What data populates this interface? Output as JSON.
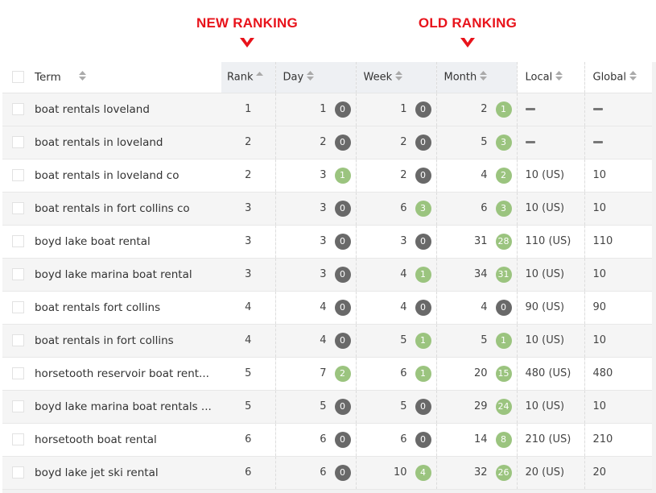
{
  "annotations": {
    "new_ranking": "NEW RANKING",
    "old_ranking": "OLD RANKING",
    "color": "#e8131b"
  },
  "table": {
    "headers": {
      "term": "Term",
      "rank": "Rank",
      "day": "Day",
      "week": "Week",
      "month": "Month",
      "local": "Local",
      "global": "Global"
    },
    "sort": {
      "column": "rank",
      "direction": "ascending"
    },
    "colors": {
      "badge_zero": "#696969",
      "badge_up": "#9bc47f",
      "header_shaded": "#eef0f3"
    },
    "rows": [
      {
        "term": "boat rentals loveland",
        "rank": "1",
        "day": "1",
        "day_change": "0",
        "week": "1",
        "week_change": "0",
        "month": "2",
        "month_change": "1",
        "local": "—",
        "global": "—"
      },
      {
        "term": "boat rentals in loveland",
        "rank": "2",
        "day": "2",
        "day_change": "0",
        "week": "2",
        "week_change": "0",
        "month": "5",
        "month_change": "3",
        "local": "—",
        "global": "—"
      },
      {
        "term": "boat rentals in loveland co",
        "rank": "2",
        "day": "3",
        "day_change": "1",
        "week": "2",
        "week_change": "0",
        "month": "4",
        "month_change": "2",
        "local": "10 (US)",
        "global": "10"
      },
      {
        "term": "boat rentals in fort collins co",
        "rank": "3",
        "day": "3",
        "day_change": "0",
        "week": "6",
        "week_change": "3",
        "month": "6",
        "month_change": "3",
        "local": "10 (US)",
        "global": "10"
      },
      {
        "term": "boyd lake boat rental",
        "rank": "3",
        "day": "3",
        "day_change": "0",
        "week": "3",
        "week_change": "0",
        "month": "31",
        "month_change": "28",
        "local": "110 (US)",
        "global": "110"
      },
      {
        "term": "boyd lake marina boat rental",
        "rank": "3",
        "day": "3",
        "day_change": "0",
        "week": "4",
        "week_change": "1",
        "month": "34",
        "month_change": "31",
        "local": "10 (US)",
        "global": "10"
      },
      {
        "term": "boat rentals fort collins",
        "rank": "4",
        "day": "4",
        "day_change": "0",
        "week": "4",
        "week_change": "0",
        "month": "4",
        "month_change": "0",
        "local": "90 (US)",
        "global": "90"
      },
      {
        "term": "boat rentals in fort collins",
        "rank": "4",
        "day": "4",
        "day_change": "0",
        "week": "5",
        "week_change": "1",
        "month": "5",
        "month_change": "1",
        "local": "10 (US)",
        "global": "10"
      },
      {
        "term": "horsetooth reservoir boat rent...",
        "rank": "5",
        "day": "7",
        "day_change": "2",
        "week": "6",
        "week_change": "1",
        "month": "20",
        "month_change": "15",
        "local": "480 (US)",
        "global": "480"
      },
      {
        "term": "boyd lake marina boat rentals ...",
        "rank": "5",
        "day": "5",
        "day_change": "0",
        "week": "5",
        "week_change": "0",
        "month": "29",
        "month_change": "24",
        "local": "10 (US)",
        "global": "10"
      },
      {
        "term": "horsetooth boat rental",
        "rank": "6",
        "day": "6",
        "day_change": "0",
        "week": "6",
        "week_change": "0",
        "month": "14",
        "month_change": "8",
        "local": "210 (US)",
        "global": "210"
      },
      {
        "term": "boyd lake jet ski rental",
        "rank": "6",
        "day": "6",
        "day_change": "0",
        "week": "10",
        "week_change": "4",
        "month": "32",
        "month_change": "26",
        "local": "20 (US)",
        "global": "20"
      }
    ]
  }
}
